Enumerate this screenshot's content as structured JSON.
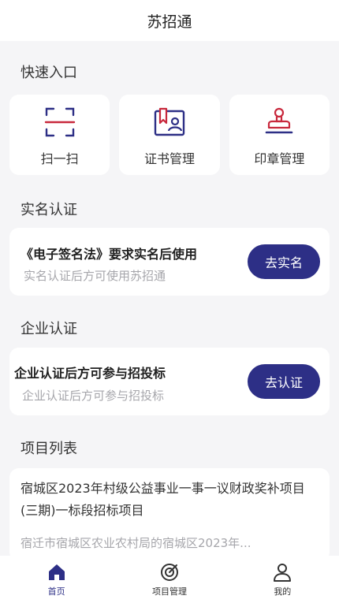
{
  "header": {
    "title": "苏招通"
  },
  "quick_entry": {
    "title": "快速入口",
    "items": [
      {
        "label": "扫一扫",
        "icon": "scan-icon"
      },
      {
        "label": "证书管理",
        "icon": "certificate-icon"
      },
      {
        "label": "印章管理",
        "icon": "seal-icon"
      }
    ]
  },
  "real_name": {
    "title": "实名认证",
    "main_text": "《电子签名法》要求实名后使用",
    "sub_text": "实名认证后方可使用苏招通",
    "button_label": "去实名"
  },
  "enterprise": {
    "title": "企业认证",
    "main_text": "企业认证后方可参与招投标",
    "sub_text": "企业认证后方可参与招投标",
    "button_label": "去认证"
  },
  "projects": {
    "title": "项目列表",
    "items": [
      {
        "title": "宿城区2023年村级公益事业一事一议财政奖补项目(三期)一标段招标项目",
        "subtitle": "宿迁市宿城区农业农村局的宿城区2023年..."
      }
    ]
  },
  "tabbar": {
    "items": [
      {
        "label": "首页",
        "icon": "home-icon",
        "active": true
      },
      {
        "label": "项目管理",
        "icon": "target-icon",
        "active": false
      },
      {
        "label": "我的",
        "icon": "user-icon",
        "active": false
      }
    ]
  },
  "colors": {
    "accent": "#2d2f86",
    "icon_red": "#c8283c",
    "background": "#f5f5f7"
  }
}
